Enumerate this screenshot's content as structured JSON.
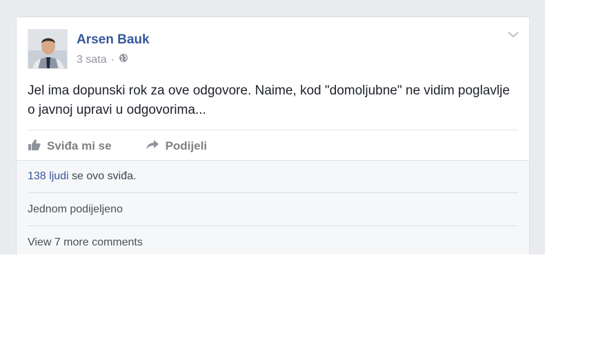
{
  "post": {
    "author": "Arsen Bauk",
    "time": "3 sata",
    "time_separator": "·",
    "text": "Jel ima dopunski rok za ove odgovore. Naime, kod \"domoljubne\" ne vidim poglavlje o javnoj upravi u odgovorima...",
    "icons": {
      "audience": "globe-icon",
      "options": "chevron-down-icon",
      "like": "thumbs-up-icon",
      "share": "share-arrow-icon"
    }
  },
  "actions": {
    "like_label": "Sviđa mi se",
    "share_label": "Podijeli"
  },
  "feedback": {
    "likes_count_link": "138 ljudi",
    "likes_suffix": " se ovo sviđa.",
    "shares_text": "Jednom podijeljeno",
    "more_comments": "View 7 more comments"
  },
  "colors": {
    "link": "#365899",
    "author": "#3b5998",
    "feed_background": "#e9ebee"
  }
}
